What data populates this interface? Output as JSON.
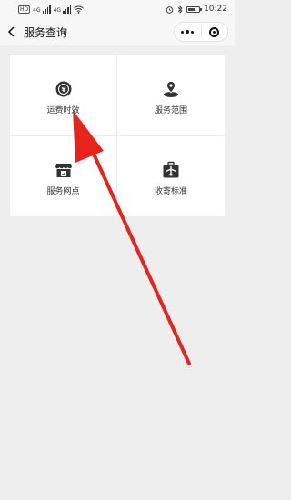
{
  "status_bar": {
    "carrier_badge": "HD",
    "network_1": "4G",
    "network_2": "4G",
    "time": "10:22"
  },
  "nav": {
    "title": "服务查询"
  },
  "services": [
    {
      "label": "运费时效",
      "icon": "clock-money-icon"
    },
    {
      "label": "服务范围",
      "icon": "location-pin-icon"
    },
    {
      "label": "服务网点",
      "icon": "store-icon"
    },
    {
      "label": "收寄标准",
      "icon": "plane-package-icon"
    }
  ],
  "colors": {
    "arrow": "#e8231b",
    "icon": "#333333",
    "background": "#eeeeee",
    "panel": "#ffffff"
  }
}
